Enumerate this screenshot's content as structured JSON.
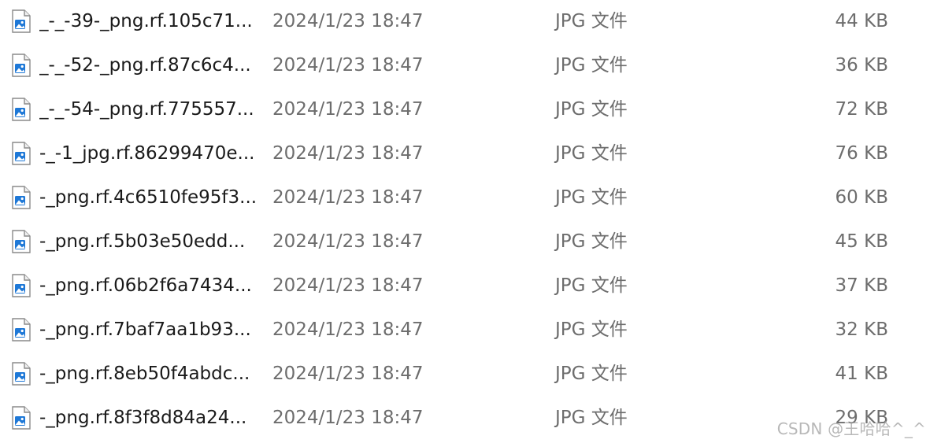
{
  "files": [
    {
      "name": "_-_-39-_png.rf.105c71...",
      "date": "2024/1/23 18:47",
      "type": "JPG 文件",
      "size": "44 KB",
      "icon": "image-file-icon"
    },
    {
      "name": "_-_-52-_png.rf.87c6c4...",
      "date": "2024/1/23 18:47",
      "type": "JPG 文件",
      "size": "36 KB",
      "icon": "image-file-icon"
    },
    {
      "name": "_-_-54-_png.rf.775557...",
      "date": "2024/1/23 18:47",
      "type": "JPG 文件",
      "size": "72 KB",
      "icon": "image-file-icon"
    },
    {
      "name": "-_-1_jpg.rf.86299470e...",
      "date": "2024/1/23 18:47",
      "type": "JPG 文件",
      "size": "76 KB",
      "icon": "image-file-icon"
    },
    {
      "name": "-_png.rf.4c6510fe95f3...",
      "date": "2024/1/23 18:47",
      "type": "JPG 文件",
      "size": "60 KB",
      "icon": "image-file-icon"
    },
    {
      "name": "-_png.rf.5b03e50edd...",
      "date": "2024/1/23 18:47",
      "type": "JPG 文件",
      "size": "45 KB",
      "icon": "image-file-icon"
    },
    {
      "name": "-_png.rf.06b2f6a7434...",
      "date": "2024/1/23 18:47",
      "type": "JPG 文件",
      "size": "37 KB",
      "icon": "image-file-icon"
    },
    {
      "name": "-_png.rf.7baf7aa1b93...",
      "date": "2024/1/23 18:47",
      "type": "JPG 文件",
      "size": "32 KB",
      "icon": "image-file-icon"
    },
    {
      "name": "-_png.rf.8eb50f4abdc...",
      "date": "2024/1/23 18:47",
      "type": "JPG 文件",
      "size": "41 KB",
      "icon": "image-file-icon"
    },
    {
      "name": "-_png.rf.8f3f8d84a24...",
      "date": "2024/1/23 18:47",
      "type": "JPG 文件",
      "size": "29 KB",
      "icon": "image-file-icon"
    }
  ],
  "watermark": "CSDN @王哈哈^_^",
  "colors": {
    "name_text": "#1a1a1a",
    "meta_text": "#6d6d6d",
    "icon_accent": "#1e78d7",
    "icon_page": "#ffffff",
    "icon_border": "#8a8a8a"
  }
}
